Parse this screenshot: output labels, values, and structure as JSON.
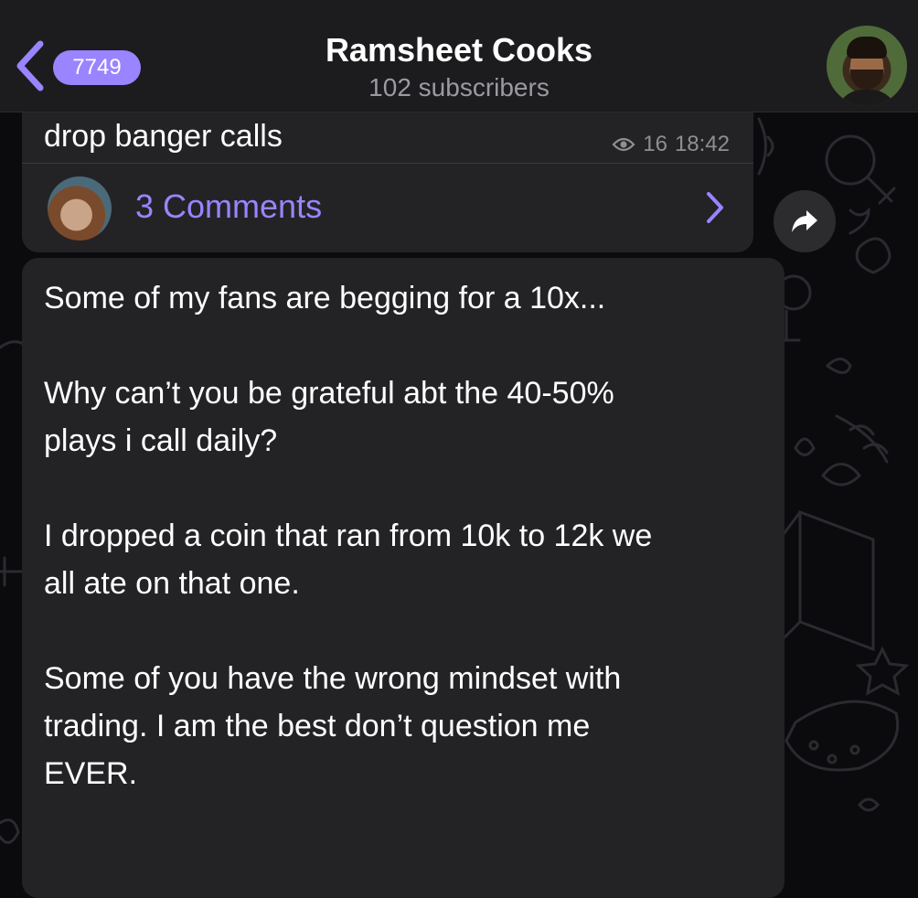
{
  "header": {
    "back_count": "7749",
    "title": "Ramsheet Cooks",
    "subtitle": "102 subscribers"
  },
  "messages": [
    {
      "text": "drop banger calls",
      "views": "16",
      "time": "18:42",
      "comments_label": "3 Comments"
    },
    {
      "text": "Some of my fans are begging for a 10x...\n\nWhy can’t you be grateful abt the 40-50%\nplays i call daily?\n\nI dropped a coin that ran from 10k to 12k we\nall ate on that one.\n\nSome of you have the wrong mindset with\ntrading. I am the best don’t question me\nEVER."
    }
  ],
  "icons": {
    "back": "chevron-left-icon",
    "views": "eye-icon",
    "comments_open": "chevron-right-icon",
    "share": "share-arrow-icon"
  },
  "colors": {
    "accent": "#9a84ff",
    "header_bg": "#1c1c1e",
    "bubble_bg": "#232326",
    "chat_bg": "#0b0b0e",
    "secondary_text": "#8e8e93"
  }
}
